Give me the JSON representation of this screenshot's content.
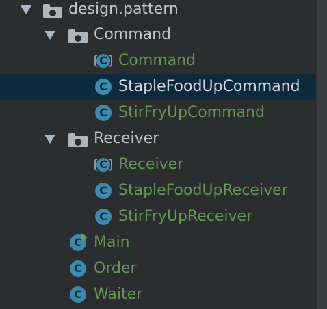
{
  "tree": {
    "root": {
      "label": "design.pattern",
      "expanded": true,
      "type": "package"
    },
    "groups": [
      {
        "label": "Command",
        "type": "package",
        "expanded": true,
        "children": [
          {
            "label": "Command",
            "type": "abstract-class"
          },
          {
            "label": "StapleFoodUpCommand",
            "type": "class",
            "selected": true
          },
          {
            "label": "StirFryUpCommand",
            "type": "class"
          }
        ]
      },
      {
        "label": "Receiver",
        "type": "package",
        "expanded": true,
        "children": [
          {
            "label": "Receiver",
            "type": "abstract-class"
          },
          {
            "label": "StapleFoodUpReceiver",
            "type": "class"
          },
          {
            "label": "StirFryUpReceiver",
            "type": "class"
          }
        ]
      }
    ],
    "root_classes": [
      {
        "label": "Main",
        "type": "runnable-class"
      },
      {
        "label": "Order",
        "type": "class"
      },
      {
        "label": "Waiter",
        "type": "class"
      }
    ],
    "icon_letter": "C"
  },
  "colors": {
    "background": "#2b2d2e",
    "selection": "#0d293e",
    "class_text": "#629755",
    "package_text": "#bcc4cc",
    "class_icon": "#3a8bb0",
    "run_badge": "#5ea34a"
  }
}
